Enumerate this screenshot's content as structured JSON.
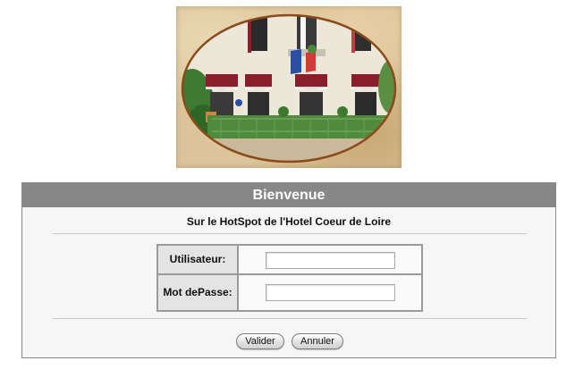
{
  "photo": {
    "subject": "hotel facade photograph",
    "accent_color": "#8a1f2b"
  },
  "panel": {
    "title": "Bienvenue",
    "subtitle": "Sur le HotSpot de l'Hotel Coeur de Loire",
    "header_color": "#878787"
  },
  "form": {
    "username_label": "Utilisateur:",
    "password_label_line1": "Mot de",
    "password_label_line2": "Passe:",
    "username_value": "",
    "password_value": ""
  },
  "buttons": {
    "submit_label": "Valider",
    "cancel_label": "Annuler"
  }
}
